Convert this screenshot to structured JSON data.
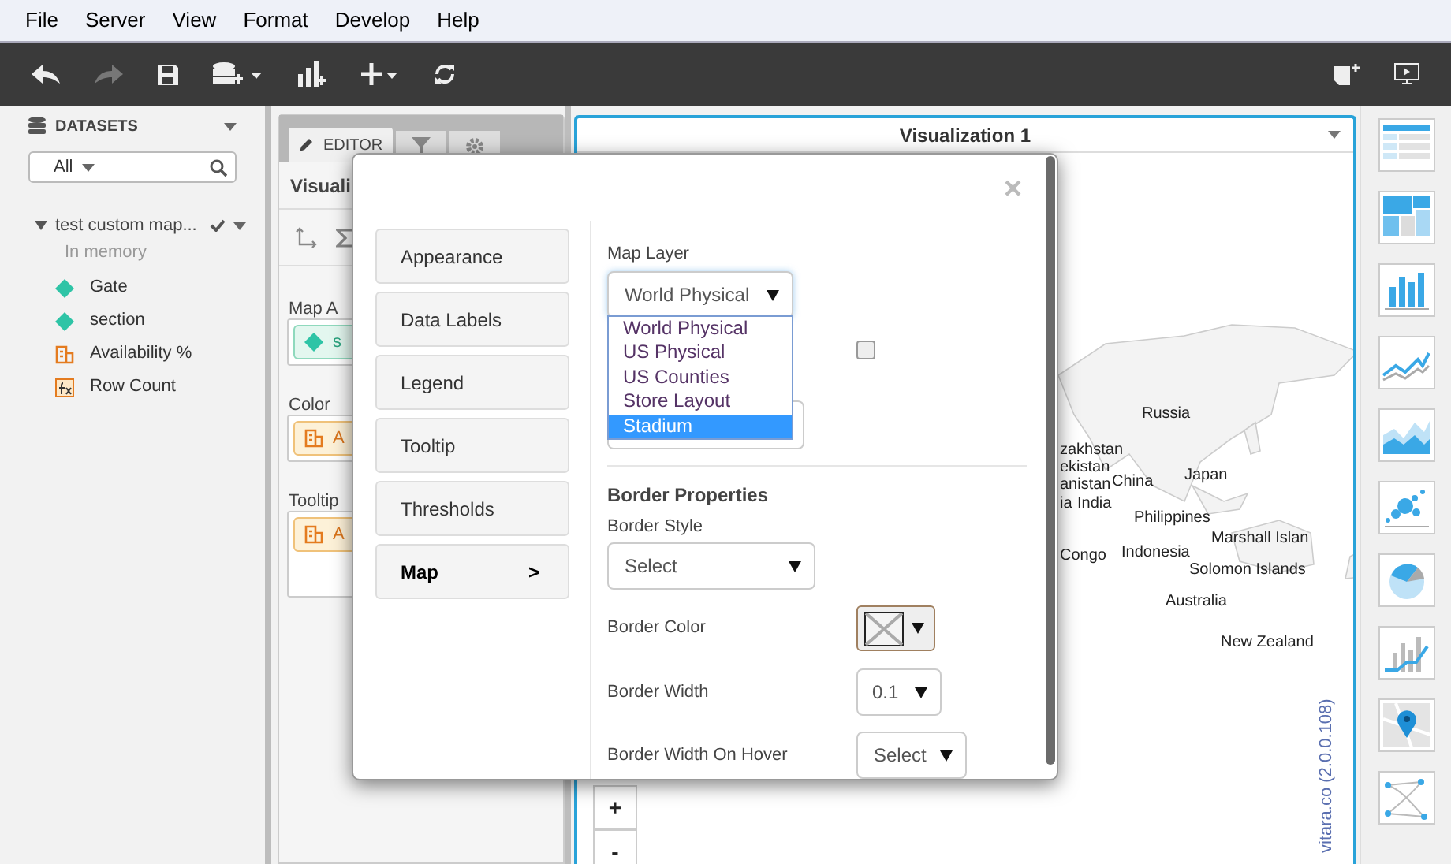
{
  "menu": [
    "File",
    "Server",
    "View",
    "Format",
    "Develop",
    "Help"
  ],
  "sidebar": {
    "title": "DATASETS",
    "filter": "All",
    "dataset": {
      "name": "test custom map...",
      "status": "In memory",
      "expanded": true,
      "fields": [
        {
          "kind": "attribute",
          "name": "Gate"
        },
        {
          "kind": "attribute",
          "name": "section"
        },
        {
          "kind": "metric",
          "name": "Availability %"
        },
        {
          "kind": "formula",
          "name": "Row Count"
        }
      ]
    }
  },
  "editor": {
    "tab": "EDITOR",
    "title": "Visuali",
    "sections": [
      {
        "label": "Map A",
        "chip": {
          "kind": "attribute",
          "text": "s"
        }
      },
      {
        "label": "Color",
        "chip": {
          "kind": "metric",
          "text": "A"
        }
      },
      {
        "label": "Tooltip",
        "chip": {
          "kind": "metric",
          "text": "A"
        }
      }
    ]
  },
  "visualization": {
    "title": "Visualization 1",
    "credit": "vitara.co (2.0.0.108)",
    "zoom": [
      "+",
      "-"
    ],
    "map_labels": [
      "Russia",
      "zakhstan",
      "ekistan",
      "anistan",
      "ia",
      "India",
      "China",
      "Japan",
      "Philippines",
      "Marshall Islan",
      "Congo",
      "Indonesia",
      "Solomon Islands",
      "Australia",
      "New Zealand"
    ]
  },
  "dialog": {
    "close": "×",
    "nav": [
      {
        "label": "Appearance",
        "selected": false
      },
      {
        "label": "Data Labels",
        "selected": false
      },
      {
        "label": "Legend",
        "selected": false
      },
      {
        "label": "Tooltip",
        "selected": false
      },
      {
        "label": "Thresholds",
        "selected": false
      },
      {
        "label": "Map",
        "selected": true,
        "arrow": ">"
      }
    ],
    "map_layer": {
      "label": "Map Layer",
      "value": "World Physical",
      "expanded": true,
      "options": [
        {
          "label": "World Physical",
          "highlighted": false
        },
        {
          "label": "US Physical",
          "highlighted": false
        },
        {
          "label": "US Counties",
          "highlighted": false
        },
        {
          "label": "Store Layout",
          "highlighted": false
        },
        {
          "label": "Stadium",
          "highlighted": true
        }
      ]
    },
    "checkbox": {
      "checked": false
    },
    "border": {
      "heading": "Border Properties",
      "style": {
        "label": "Border Style",
        "value": "Select"
      },
      "color": {
        "label": "Border Color"
      },
      "width": {
        "label": "Border Width",
        "value": "0.1"
      },
      "hover": {
        "label": "Border Width On Hover",
        "value": "Select"
      }
    }
  }
}
